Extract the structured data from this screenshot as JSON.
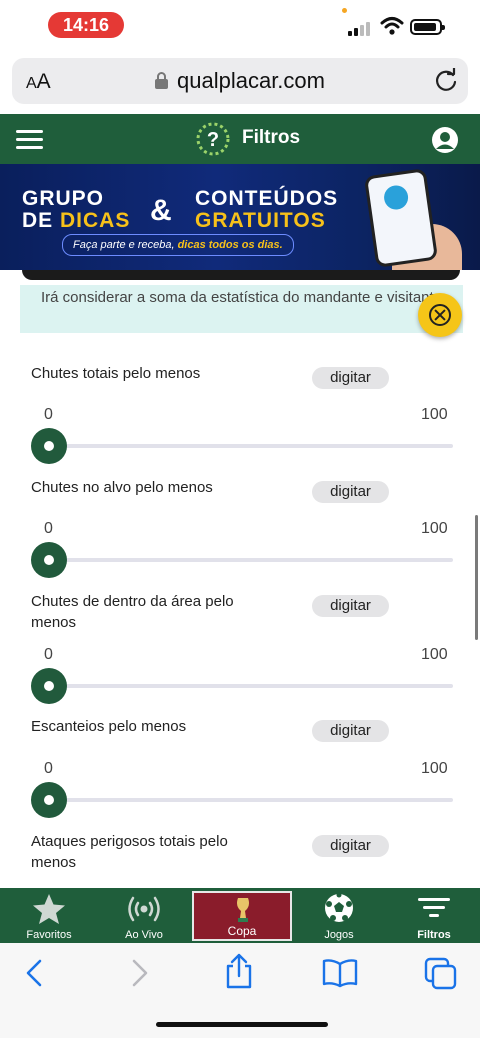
{
  "status": {
    "time": "14:16"
  },
  "browser": {
    "aa_big": "A",
    "aa_small": "A",
    "url": "qualplacar.com"
  },
  "header": {
    "title": "Filtros"
  },
  "banner": {
    "line1a": "GRUPO",
    "line1b_white": "DE ",
    "line1b_yellow": "DICAS",
    "amp": "&",
    "line2a": "CONTEÚDOS",
    "line2b": "GRATUITOS",
    "sub_plain": "Faça parte e receba, ",
    "sub_bold": "dicas todos os dias."
  },
  "info": {
    "text": "Irá considerar a soma da estatística do mandante e visitante"
  },
  "filters": [
    {
      "label": "Chutes totais pelo menos",
      "button": "digitar",
      "min": "0",
      "max": "100",
      "value": 0
    },
    {
      "label": "Chutes no alvo pelo menos",
      "button": "digitar",
      "min": "0",
      "max": "100",
      "value": 0
    },
    {
      "label": "Chutes de dentro da área pelo menos",
      "button": "digitar",
      "min": "0",
      "max": "100",
      "value": 0
    },
    {
      "label": "Escanteios pelo menos",
      "button": "digitar",
      "min": "0",
      "max": "100",
      "value": 0
    },
    {
      "label": "Ataques perigosos totais pelo menos",
      "button": "digitar"
    }
  ],
  "tabs": {
    "favoritos": "Favoritos",
    "ao_vivo": "Ao Vivo",
    "copa": "Copa",
    "jogos": "Jogos",
    "filtros": "Filtros"
  },
  "colors": {
    "brand_green": "#1f5e3b",
    "accent_yellow": "#f5c518",
    "copa_red": "#8a1c2b",
    "time_red": "#e53935"
  }
}
